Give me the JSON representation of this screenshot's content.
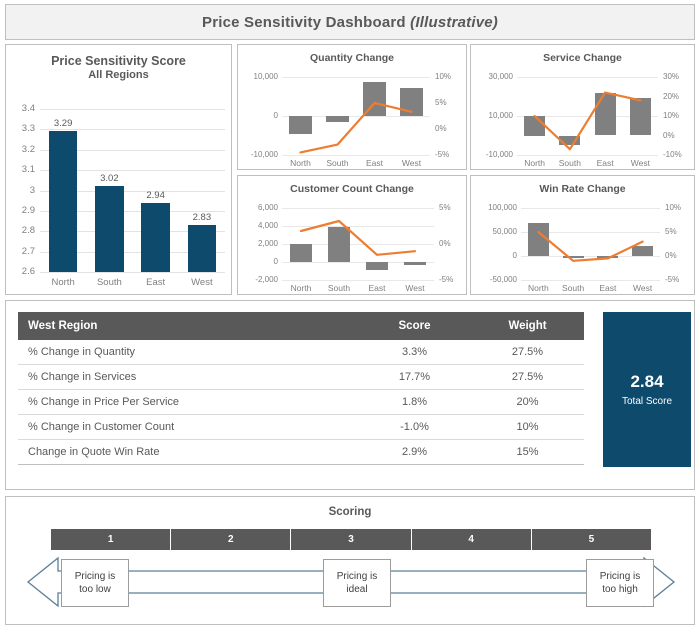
{
  "header": {
    "title_main": "Price Sensitivity Dashboard",
    "title_italic": "(Illustrative)"
  },
  "colors": {
    "dark_blue": "#0e4a6b",
    "gray_bar": "#808080",
    "orange_line": "#ED7D31",
    "header_bg": "#f2f2f2",
    "table_header": "#595959"
  },
  "chart_data": [
    {
      "id": "price_sensitivity_score",
      "type": "bar",
      "title": "Price Sensitivity Score",
      "subtitle": "All Regions",
      "categories": [
        "North",
        "South",
        "East",
        "West"
      ],
      "values": [
        3.29,
        3.02,
        2.94,
        2.83
      ],
      "data_labels": [
        "3.29",
        "3.02",
        "2.94",
        "2.83"
      ],
      "ylim": [
        2.6,
        3.4
      ],
      "yticks": [
        3.4,
        3.3,
        3.2,
        3.1,
        3,
        2.9,
        2.8,
        2.7,
        2.6
      ],
      "ytick_labels": [
        "3.4",
        "3.3",
        "3.2",
        "3.1",
        "3",
        "2.9",
        "2.8",
        "2.7",
        "2.6"
      ],
      "xlabel": "",
      "ylabel": "",
      "grid": true,
      "legend": "none"
    },
    {
      "id": "quantity_change",
      "type": "bar+line",
      "title": "Quantity Change",
      "categories": [
        "North",
        "South",
        "East",
        "West"
      ],
      "series": [
        {
          "name": "Quantity",
          "type": "bar",
          "axis": "left",
          "values": [
            -4500,
            -1500,
            8800,
            7200
          ]
        },
        {
          "name": "% Change",
          "type": "line",
          "axis": "right",
          "values": [
            -4.5,
            -3.0,
            5.0,
            3.3
          ]
        }
      ],
      "ylim": [
        -10000,
        10000
      ],
      "yticks": [
        10000,
        0,
        -10000
      ],
      "ytick_labels": [
        "10,000",
        "0",
        "-10,000"
      ],
      "y2lim": [
        -5,
        10
      ],
      "y2ticks": [
        10,
        5,
        0,
        -5
      ],
      "y2tick_labels": [
        "10%",
        "5%",
        "0%",
        "-5%"
      ],
      "grid": true,
      "legend": "none"
    },
    {
      "id": "service_change",
      "type": "bar+line",
      "title": "Service Change",
      "categories": [
        "North",
        "South",
        "East",
        "West"
      ],
      "series": [
        {
          "name": "Services",
          "type": "bar",
          "axis": "left",
          "values": [
            10000,
            -5000,
            22000,
            19000
          ]
        },
        {
          "name": "% Change",
          "type": "line",
          "axis": "right",
          "values": [
            10,
            -7,
            22,
            18
          ]
        }
      ],
      "ylim": [
        -10000,
        30000
      ],
      "yticks": [
        30000,
        10000,
        -10000
      ],
      "ytick_labels": [
        "30,000",
        "10,000",
        "-10,000"
      ],
      "y2lim": [
        -10,
        30
      ],
      "y2ticks": [
        30,
        20,
        10,
        0,
        -10
      ],
      "y2tick_labels": [
        "30%",
        "20%",
        "10%",
        "0%",
        "-10%"
      ],
      "grid": true,
      "legend": "none"
    },
    {
      "id": "customer_count_change",
      "type": "bar+line",
      "title": "Customer Count Change",
      "categories": [
        "North",
        "South",
        "East",
        "West"
      ],
      "series": [
        {
          "name": "Customer Count",
          "type": "bar",
          "axis": "left",
          "values": [
            2000,
            3900,
            -900,
            -300
          ]
        },
        {
          "name": "% Change",
          "type": "line",
          "axis": "right",
          "values": [
            1.8,
            3.2,
            -1.5,
            -1.0
          ]
        }
      ],
      "ylim": [
        -2000,
        6000
      ],
      "yticks": [
        6000,
        4000,
        2000,
        0,
        -2000
      ],
      "ytick_labels": [
        "6,000",
        "4,000",
        "2,000",
        "0",
        "-2,000"
      ],
      "y2lim": [
        -5,
        5
      ],
      "y2ticks": [
        5,
        0,
        -5
      ],
      "y2tick_labels": [
        "5%",
        "0%",
        "-5%"
      ],
      "grid": true,
      "legend": "none"
    },
    {
      "id": "win_rate_change",
      "type": "bar+line",
      "title": "Win Rate Change",
      "categories": [
        "North",
        "South",
        "East",
        "West"
      ],
      "series": [
        {
          "name": "Win Rate",
          "type": "bar",
          "axis": "left",
          "values": [
            68000,
            -2000,
            -1500,
            20000
          ]
        },
        {
          "name": "% Change",
          "type": "line",
          "axis": "right",
          "values": [
            5.0,
            -1.0,
            -0.5,
            3.0
          ]
        }
      ],
      "ylim": [
        -50000,
        100000
      ],
      "yticks": [
        100000,
        50000,
        0,
        -50000
      ],
      "ytick_labels": [
        "100,000",
        "50,000",
        "0",
        "-50,000"
      ],
      "y2lim": [
        -5,
        10
      ],
      "y2ticks": [
        10,
        5,
        0,
        -5
      ],
      "y2tick_labels": [
        "10%",
        "5%",
        "0%",
        "-5%"
      ],
      "grid": true,
      "legend": "none"
    }
  ],
  "table": {
    "headers": [
      "West Region",
      "Score",
      "Weight"
    ],
    "rows": [
      {
        "metric": "% Change in Quantity",
        "score": "3.3%",
        "weight": "27.5%"
      },
      {
        "metric": "% Change in Services",
        "score": "17.7%",
        "weight": "27.5%"
      },
      {
        "metric": "% Change in Price Per Service",
        "score": "1.8%",
        "weight": "20%"
      },
      {
        "metric": "% Change in Customer Count",
        "score": "-1.0%",
        "weight": "10%"
      },
      {
        "metric": "Change in Quote Win Rate",
        "score": "2.9%",
        "weight": "15%"
      }
    ]
  },
  "total_score": {
    "value": "2.84",
    "label": "Total Score"
  },
  "scoring": {
    "title": "Scoring",
    "segments": [
      "1",
      "2",
      "3",
      "4",
      "5"
    ],
    "callouts": [
      {
        "line1": "Pricing is",
        "line2": "too low"
      },
      {
        "line1": "Pricing is",
        "line2": "ideal"
      },
      {
        "line1": "Pricing is",
        "line2": "too high"
      }
    ]
  }
}
